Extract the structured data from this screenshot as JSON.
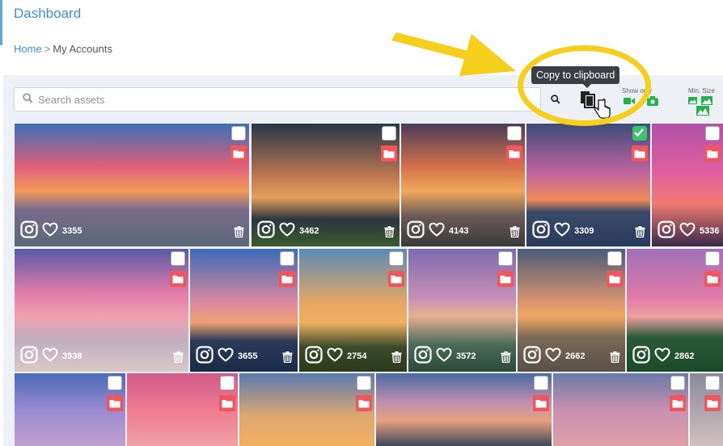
{
  "header": {
    "title": "Dashboard"
  },
  "breadcrumb": {
    "home": "Home",
    "separator": ">",
    "current": "My Accounts"
  },
  "search": {
    "placeholder": "Search assets",
    "value": ""
  },
  "toolbar": {
    "tooltip": "Copy to clipboard",
    "show_only_label": "Show only",
    "min_size_label": "Min. Size",
    "accent_green": "#22b24c"
  },
  "annotation": {
    "color": "#f5cf1b"
  },
  "assets": [
    {
      "likes": "3355",
      "checked": false
    },
    {
      "likes": "3462",
      "checked": false
    },
    {
      "likes": "4143",
      "checked": false
    },
    {
      "likes": "3309",
      "checked": true
    },
    {
      "likes": "5336",
      "checked": false
    },
    {
      "likes": "3938",
      "checked": false
    },
    {
      "likes": "3655",
      "checked": false
    },
    {
      "likes": "2754",
      "checked": false
    },
    {
      "likes": "3572",
      "checked": false
    },
    {
      "likes": "2662",
      "checked": false
    },
    {
      "likes": "2862",
      "checked": false
    },
    {
      "likes": "",
      "checked": false
    },
    {
      "likes": "",
      "checked": false
    },
    {
      "likes": "",
      "checked": false
    },
    {
      "likes": "",
      "checked": false
    },
    {
      "likes": "",
      "checked": false
    },
    {
      "likes": "",
      "checked": false
    }
  ]
}
